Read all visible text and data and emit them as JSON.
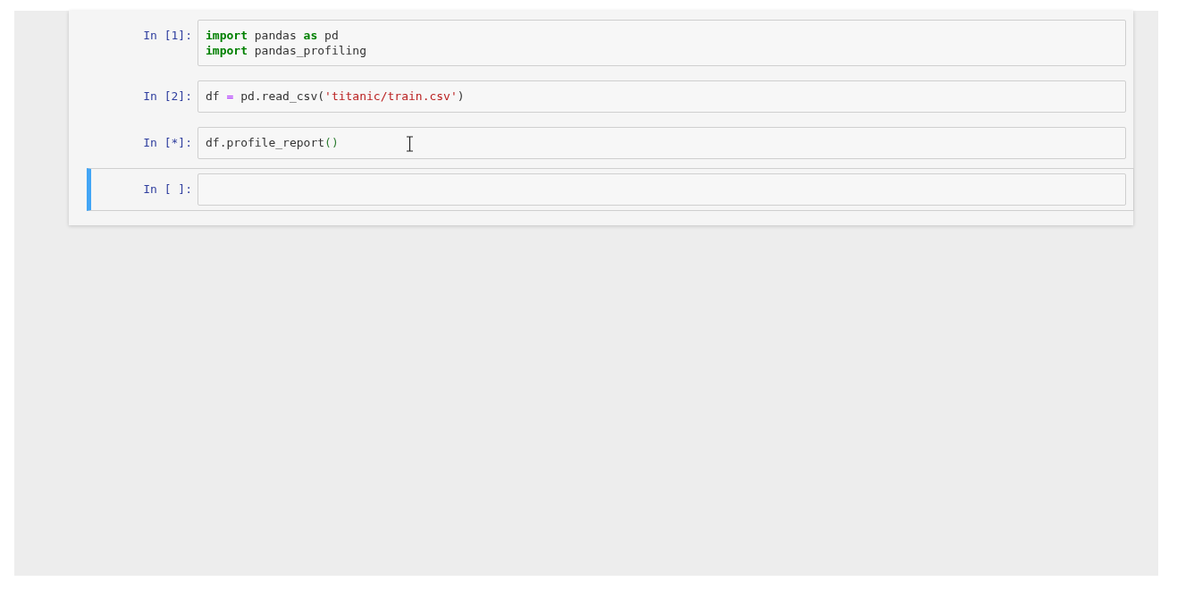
{
  "cells": [
    {
      "prompt": "In [1]:",
      "selected": false,
      "lines": [
        [
          {
            "kind": "keyword",
            "text": "import"
          },
          {
            "kind": "plain",
            "text": " pandas "
          },
          {
            "kind": "keyword",
            "text": "as"
          },
          {
            "kind": "plain",
            "text": " pd"
          }
        ],
        [
          {
            "kind": "keyword",
            "text": "import"
          },
          {
            "kind": "plain",
            "text": " pandas_profiling"
          }
        ]
      ]
    },
    {
      "prompt": "In [2]:",
      "selected": false,
      "lines": [
        [
          {
            "kind": "plain",
            "text": "df "
          },
          {
            "kind": "operator",
            "text": "="
          },
          {
            "kind": "plain",
            "text": " pd.read_csv("
          },
          {
            "kind": "string",
            "text": "'titanic/train.csv'"
          },
          {
            "kind": "plain",
            "text": ")"
          }
        ]
      ]
    },
    {
      "prompt": "In [*]:",
      "selected": false,
      "cursor": true,
      "lines": [
        [
          {
            "kind": "plain",
            "text": "df.profile_report"
          },
          {
            "kind": "paren",
            "text": "()"
          }
        ]
      ]
    },
    {
      "prompt": "In [ ]:",
      "selected": true
    }
  ]
}
